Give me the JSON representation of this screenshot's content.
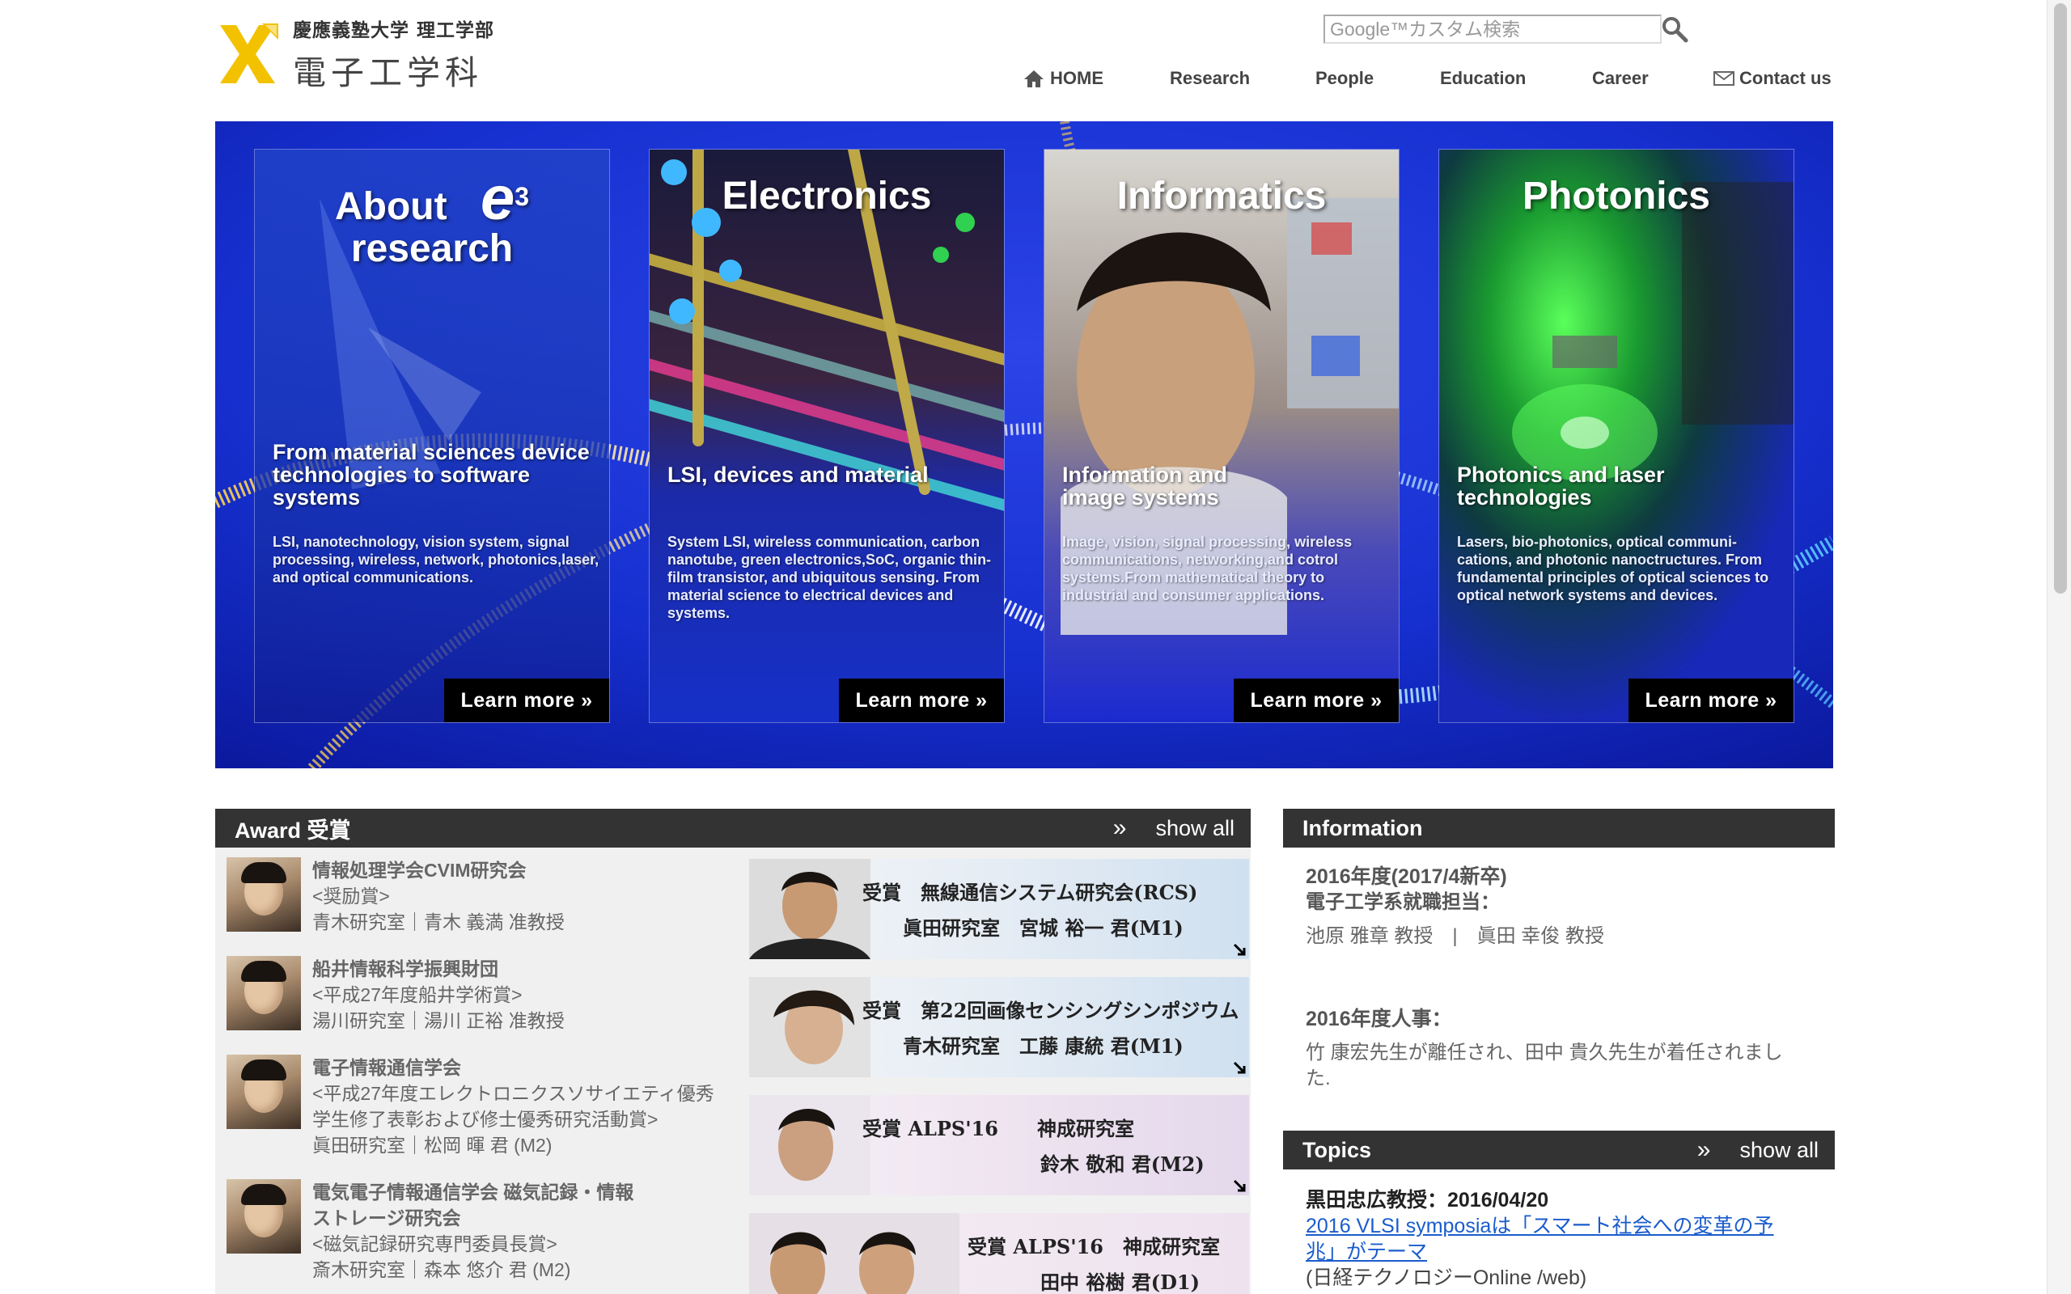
{
  "header": {
    "logo_sub": "慶應義塾大学 理工学部",
    "logo_main": "電子工学科",
    "search_placeholder": "Google™カスタム検索",
    "nav": [
      {
        "label": "HOME",
        "icon": "home-icon"
      },
      {
        "label": "Research"
      },
      {
        "label": "People"
      },
      {
        "label": "Education"
      },
      {
        "label": "Career"
      },
      {
        "label": "Contact us",
        "icon": "mail-icon"
      }
    ]
  },
  "hero": {
    "panels": [
      {
        "title_line1": "About",
        "title_mark": "e",
        "title_mark_sup": "3",
        "title_line2": "research",
        "subtitle": "From material sciences device technologies to software systems",
        "description": "LSI, nanotechnology, vision system, signal processing, wireless, network, photonics,laser, and optical communications.",
        "button": "Learn more »"
      },
      {
        "title": "Electronics",
        "subtitle": "LSI, devices and material",
        "description": "System LSI, wireless communication, carbon nanotube, green electronics,SoC, organic thin-film transistor, and ubiquitous sensing. From material science to electrical devices and systems.",
        "button": "Learn more »"
      },
      {
        "title": "Informatics",
        "subtitle": "Information and image systems",
        "description": "Image, vision, signal processing, wireless communications, networking,and cotrol systems.From mathematical theory to industrial and consumer applications.",
        "button": "Learn more »"
      },
      {
        "title": "Photonics",
        "subtitle": "Photonics and laser technologies",
        "description": "Lasers, bio-photonics, optical communi-cations, and photonic nanoctructures. From fundamental principles of optical sciences to optical network systems and devices.",
        "button": "Learn more »"
      }
    ]
  },
  "award": {
    "title": "Award 受賞",
    "show_all": "show all",
    "items": [
      {
        "org": "情報処理学会CVIM研究会",
        "prize": "<奨励賞>",
        "person": "青木研究室｜青木 義満 准教授"
      },
      {
        "org": "船井情報科学振興財団",
        "prize": "<平成27年度船井学術賞>",
        "person": "湯川研究室｜湯川 正裕 准教授"
      },
      {
        "org": "電子情報通信学会",
        "prize": "<平成27年度エレクトロニクスソサイエティ優秀学生修了表彰および修士優秀研究活動賞>",
        "person": "眞田研究室｜松岡 暉 君 (M2)"
      },
      {
        "org": "電気電子情報通信学会 磁気記録・情報ストレージ研究会",
        "prize": "<磁気記録研究専門委員長賞>",
        "person": "斎木研究室｜森本 悠介 君 (M2)"
      }
    ],
    "banners": [
      {
        "line1": "受賞　無線通信システム研究会(RCS)",
        "line2": "眞田研究室　宮城 裕一 君(M1)"
      },
      {
        "line1": "受賞　第22回画像センシングシンポジウム",
        "line2": "青木研究室　工藤 康統 君(M1)"
      },
      {
        "line1": "受賞 ALPS'16　　神成研究室",
        "line2": "鈴木 敬和 君(M2)"
      },
      {
        "line1": "受賞 ALPS'16　神成研究室",
        "line2": "田中 裕樹 君(D1)"
      }
    ]
  },
  "information": {
    "title": "Information",
    "block1_title": "2016年度(2017/4新卒)",
    "block1_sub": "電子工学系就職担当：",
    "block1_body": "池原 雅章 教授　|　眞田 幸俊 教授",
    "block2_title": "2016年度人事：",
    "block2_body": "竹 康宏先生が離任され、田中 貴久先生が着任されました."
  },
  "topics": {
    "title": "Topics",
    "show_all": "show all",
    "item_head": "黒田忠広教授：2016/04/20",
    "item_link": "2016 VLSI symposiaは「スマート社会への変革の予兆」がテーマ",
    "item_source": "(日経テクノロジーOnline /web)"
  },
  "colors": {
    "hero_blue": "#1428c8",
    "section_bar": "#333333",
    "logo_yellow": "#f2c200",
    "link": "#1a5ccc"
  }
}
